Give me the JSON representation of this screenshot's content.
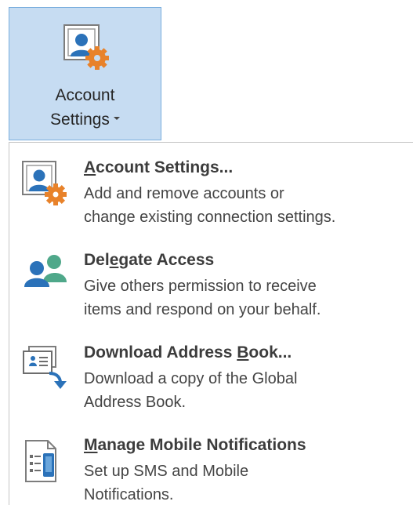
{
  "ribbon_button": {
    "label_line1": "Account",
    "label_line2": "Settings",
    "icon": "account-settings-icon",
    "state": "expanded"
  },
  "menu": {
    "items": [
      {
        "title_pre": "",
        "title_key": "A",
        "title_post": "ccount Settings...",
        "desc_line1": "Add and remove accounts or",
        "desc_line2": "change existing connection settings.",
        "icon": "account-settings-icon"
      },
      {
        "title_pre": "Del",
        "title_key": "e",
        "title_post": "gate Access",
        "desc_line1": "Give others permission to receive",
        "desc_line2": "items and respond on your behalf.",
        "icon": "delegate-users-icon"
      },
      {
        "title_pre": "Download Address ",
        "title_key": "B",
        "title_post": "ook...",
        "desc_line1": "Download a copy of the Global",
        "desc_line2": "Address Book.",
        "icon": "download-address-book-icon"
      },
      {
        "title_pre": "",
        "title_key": "M",
        "title_post": "anage Mobile Notifications",
        "desc_line1": "Set up SMS and Mobile",
        "desc_line2": "Notifications.",
        "icon": "mobile-notifications-icon"
      }
    ]
  },
  "colors": {
    "button_pressed_bg": "#c6dcf2",
    "button_pressed_border": "#7aaede",
    "icon_blue": "#2b72b9",
    "icon_orange": "#e8822a",
    "icon_green": "#4fa88a",
    "text": "#3c3c3c"
  }
}
